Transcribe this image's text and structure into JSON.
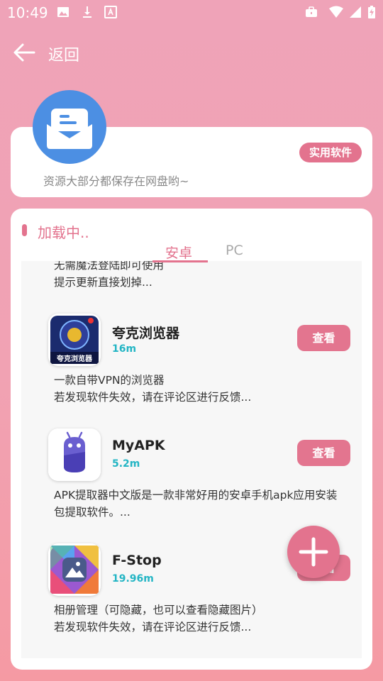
{
  "status_bar": {
    "time": "10:49"
  },
  "app_bar": {
    "back_label": "返回"
  },
  "header": {
    "tag": "实用软件",
    "notice": "资源大部分都保存在网盘哟~"
  },
  "main": {
    "loading": "加载中..",
    "tabs": [
      {
        "label": "安卓",
        "active": true
      },
      {
        "label": "PC",
        "active": false
      }
    ],
    "partial_item": {
      "desc_line1": "无需魔法登陆即可使用",
      "desc_line2": "提示更新直接划掉..."
    },
    "items": [
      {
        "name": "夸克浏览器",
        "size": "16m",
        "button": "查看",
        "icon_text": "夸克浏览器",
        "desc_line1": "一款自带VPN的浏览器",
        "desc_line2": "若发现软件失效，请在评论区进行反馈..."
      },
      {
        "name": "MyAPK",
        "size": "5.2m",
        "button": "查看",
        "desc_line1": "APK提取器中文版是一款非常好用的安卓手机apk应用安装",
        "desc_line2": "包提取软件。..."
      },
      {
        "name": "F-Stop",
        "size": "19.96m",
        "button": "查看",
        "desc_line1": "相册管理（可隐藏，也可以查看隐藏图片）",
        "desc_line2": "若发现软件失效，请在评论区进行反馈..."
      }
    ]
  },
  "colors": {
    "accent": "#e3738e",
    "size_text": "#23b5c4",
    "avatar": "#4c8fe3"
  }
}
